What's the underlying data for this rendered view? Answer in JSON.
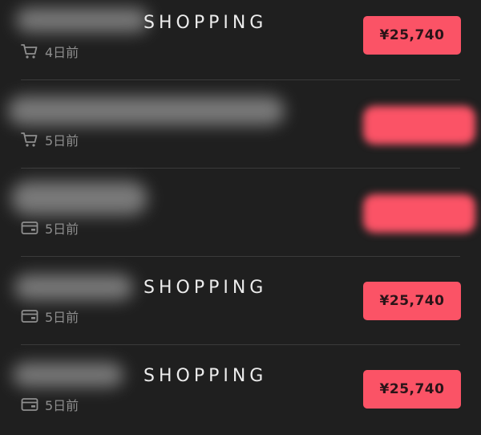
{
  "items": [
    {
      "title": "SHOPPING",
      "icon": "cart-icon",
      "time": "4日前",
      "price": "¥25,740",
      "price_visible": true
    },
    {
      "title": "",
      "icon": "cart-icon",
      "time": "5日前",
      "price": "",
      "price_visible": false
    },
    {
      "title": "",
      "icon": "wallet-icon",
      "time": "5日前",
      "price": "",
      "price_visible": false
    },
    {
      "title": "SHOPPING",
      "icon": "wallet-icon",
      "time": "5日前",
      "price": "¥25,740",
      "price_visible": true
    },
    {
      "title": "SHOPPING",
      "icon": "wallet-icon",
      "time": "5日前",
      "price": "¥25,740",
      "price_visible": true
    }
  ],
  "colors": {
    "background": "#1f1f1f",
    "divider": "#3a3a3a",
    "price_badge": "#fb5366",
    "meta_text": "#8e8e8e",
    "title_text": "#ececec"
  }
}
